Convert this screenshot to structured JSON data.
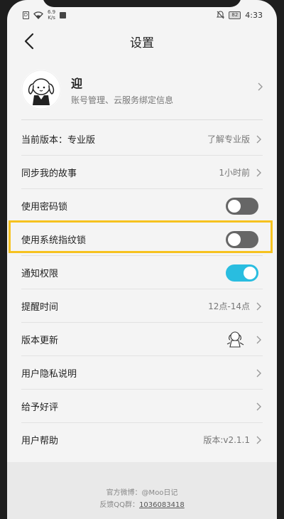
{
  "status_bar": {
    "sim": "D",
    "speed_value": "6.9",
    "speed_unit": "K/s",
    "battery": "82",
    "time": "4:33"
  },
  "header": {
    "title": "设置",
    "back_icon": "chevron-left-icon"
  },
  "profile": {
    "name": "迎",
    "subtitle": "账号管理、云服务绑定信息"
  },
  "settings": [
    {
      "label": "当前版本：专业版",
      "value": "了解专业版",
      "type": "link"
    },
    {
      "label": "同步我的故事",
      "value": "1小时前",
      "type": "link"
    },
    {
      "label": "使用密码锁",
      "type": "toggle",
      "on": false
    },
    {
      "label": "使用系统指纹锁",
      "type": "toggle",
      "on": false,
      "highlighted": true
    },
    {
      "label": "通知权限",
      "type": "toggle",
      "on": true
    },
    {
      "label": "提醒时间",
      "value": "12点-14点",
      "type": "link"
    },
    {
      "label": "版本更新",
      "type": "link",
      "icon": "sketch-illustration-icon"
    },
    {
      "label": "用户隐私说明",
      "type": "link"
    },
    {
      "label": "给予好评",
      "type": "link"
    },
    {
      "label": "用户帮助",
      "value": "版本:v2.1.1",
      "type": "link"
    }
  ],
  "footer": {
    "weibo": "官方微博：@Moo日记",
    "qq_label": "反馈QQ群：",
    "qq_number": "1036083418"
  },
  "colors": {
    "accent": "#29bde0",
    "highlight": "#f6c21f",
    "toggle_off": "#666666"
  }
}
